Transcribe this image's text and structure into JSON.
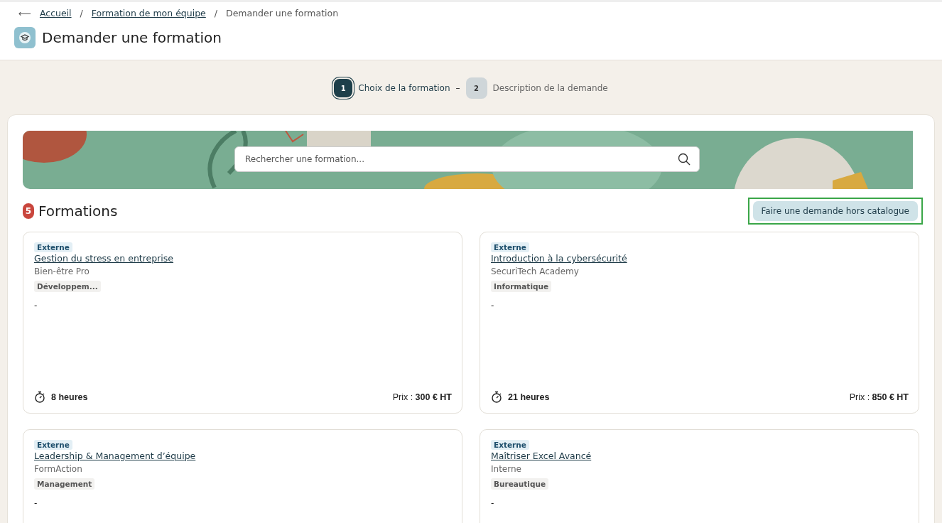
{
  "breadcrumb": {
    "back": "⟵",
    "items": [
      {
        "label": "Accueil",
        "link": true
      },
      {
        "label": "Formation de mon équipe",
        "link": true
      },
      {
        "label": "Demander une formation",
        "link": false
      }
    ],
    "separator": "/"
  },
  "page_title": "Demander une formation",
  "steps": [
    {
      "number": "1",
      "label": "Choix de la formation",
      "selected": true
    },
    {
      "number": "2",
      "label": "Description de la demande",
      "selected": false
    }
  ],
  "step_separator": "–",
  "search": {
    "placeholder": "Rechercher une formation..."
  },
  "formations_header": {
    "count": "5",
    "title": "Formations",
    "button": "Faire une demande hors catalogue"
  },
  "cards": [
    {
      "badge": "Externe",
      "title": "Gestion du stress en entreprise",
      "provider": "Bien-être Pro",
      "tag": "Développem...",
      "description": "-",
      "duration": "8 heures",
      "price": "Prix : **300 € HT**"
    },
    {
      "badge": "Externe",
      "title": "Introduction à la cybersécurité",
      "provider": "SecuriTech Academy",
      "tag": "Informatique",
      "description": "-",
      "duration": "21 heures",
      "price": "Prix : **850 € HT**"
    },
    {
      "badge": "Externe",
      "title": "Leadership & Management d’équipe",
      "provider": "FormAction",
      "tag": "Management",
      "description": "-"
    },
    {
      "badge": "Externe",
      "title": "Maîtriser Excel Avancé",
      "provider": "Interne",
      "tag": "Bureautique",
      "description": "-"
    }
  ]
}
